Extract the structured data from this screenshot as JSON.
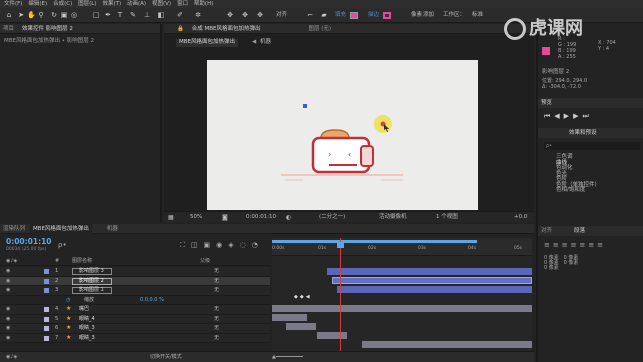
{
  "menu": [
    "文件(F)",
    "编辑(E)",
    "合成(C)",
    "图层(L)",
    "效果(T)",
    "动画(A)",
    "视图(V)",
    "窗口",
    "帮助(H)"
  ],
  "toolbar": {
    "align_label": "对齐",
    "fill_label": "填充",
    "stroke_label": "描边",
    "stroke_value": "像素",
    "add_label": "添加",
    "workspace_label": "工作区：",
    "workspace_value": "标准"
  },
  "left_panel": {
    "tabs": [
      "项目",
      "效果控件 影响图层 2"
    ],
    "breadcrumb": "MBE风格面包加热弹出 • 影响图层 2"
  },
  "comp_panel": {
    "header_tab": "合成 MBE风格面包加热弹出",
    "layer_tab": "图层 (无)",
    "subtabs": [
      "MBE风格面包加热弹出",
      "机器"
    ],
    "footer": {
      "zoom": "50%",
      "timecode": "0:00:01:10",
      "resolution": "(二分之一)",
      "camera": "活动摄像机",
      "views": "1 个视图",
      "offset": "+0.0"
    }
  },
  "right_panel": {
    "info_rgb": [
      "R :",
      "G : 199",
      "B : 199",
      "A : 255"
    ],
    "info_xy": [
      "X : 704",
      "Y : 4"
    ],
    "layer_name": "影响图层 2",
    "pos_lines": [
      "位置: 294.0, 294.0",
      "Δ: -304.0, -72.0"
    ],
    "preview_title": "预览",
    "effects_title": "效果和预设",
    "effects_search": "ρ•",
    "effects_list": [
      "三色调",
      "曲线",
      "色调化",
      "色光",
      "色阶",
      "色阶（单独控件）",
      "色相/饱和度"
    ],
    "align_title": "对齐",
    "paragraph_title": "段落",
    "para_values": [
      "0 像素",
      "0 像素",
      "0 像素",
      "0 像素",
      "0 像素"
    ]
  },
  "timeline": {
    "tabs": [
      "渲染队列",
      "MBE风格面包加热弹出",
      "机器"
    ],
    "timecode": "0:00:01:10",
    "fps": "00034 (25.00 fps)",
    "col_num": "#",
    "col_name": "图层名称",
    "col_parent": "父级",
    "ruler": [
      "0:00s",
      "01s",
      "02s",
      "03s",
      "04s",
      "05s"
    ],
    "layers": [
      {
        "num": "1",
        "name": "影响图层 3",
        "parent": "无"
      },
      {
        "num": "2",
        "name": "影响图层 2",
        "parent": "无"
      },
      {
        "num": "3",
        "name": "影响图层 1",
        "parent": "无"
      },
      {
        "num": "",
        "name": "缩放",
        "parent": "0.0,0.0 %"
      },
      {
        "num": "4",
        "name": "嘴巴",
        "parent": "无"
      },
      {
        "num": "5",
        "name": "眼睛_4",
        "parent": "无"
      },
      {
        "num": "6",
        "name": "眼睛_3",
        "parent": "无"
      },
      {
        "num": "7",
        "name": "眼睛_3",
        "parent": "无"
      }
    ],
    "footer_label": "切换开关/模式"
  },
  "watermark": "虎课网",
  "colors": {
    "accent_blue": "#5aa7e6",
    "fill_swatch": "#e8489a",
    "bar_blue": "#5a67b8",
    "toaster_red": "#c0303a",
    "bread": "#e8a96a",
    "sparkle": "#f0e04a"
  }
}
